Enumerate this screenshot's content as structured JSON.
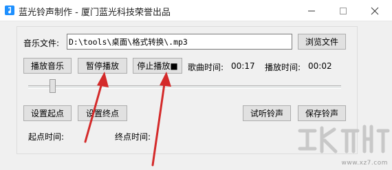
{
  "window": {
    "title": "蓝光铃声制作 - 厦门蓝光科技荣誉出品",
    "icon": "music-note-icon"
  },
  "file": {
    "label": "音乐文件:",
    "path": "D:\\tools\\桌面\\格式转换\\.mp3",
    "browse_label": "浏览文件"
  },
  "playback": {
    "play_label": "播放音乐",
    "pause_label": "暂停播放",
    "stop_label": "停止播放■",
    "song_time_label": "歌曲时间:",
    "song_time_value": "00:17",
    "play_time_label": "播放时间:",
    "play_time_value": "00:02",
    "position_fraction": 0.07
  },
  "marks": {
    "set_start_label": "设置起点",
    "set_end_label": "设置终点",
    "preview_label": "试听铃声",
    "save_label": "保存铃声",
    "start_time_label": "起点时间:",
    "end_time_label": "终点时间:"
  },
  "watermark": {
    "text": "www.xz7.com"
  },
  "colors": {
    "arrow": "#d42a2a",
    "button_face": "#e1e1e1",
    "window_bg": "#f0f0f0",
    "icon_blue": "#1e90ff"
  }
}
